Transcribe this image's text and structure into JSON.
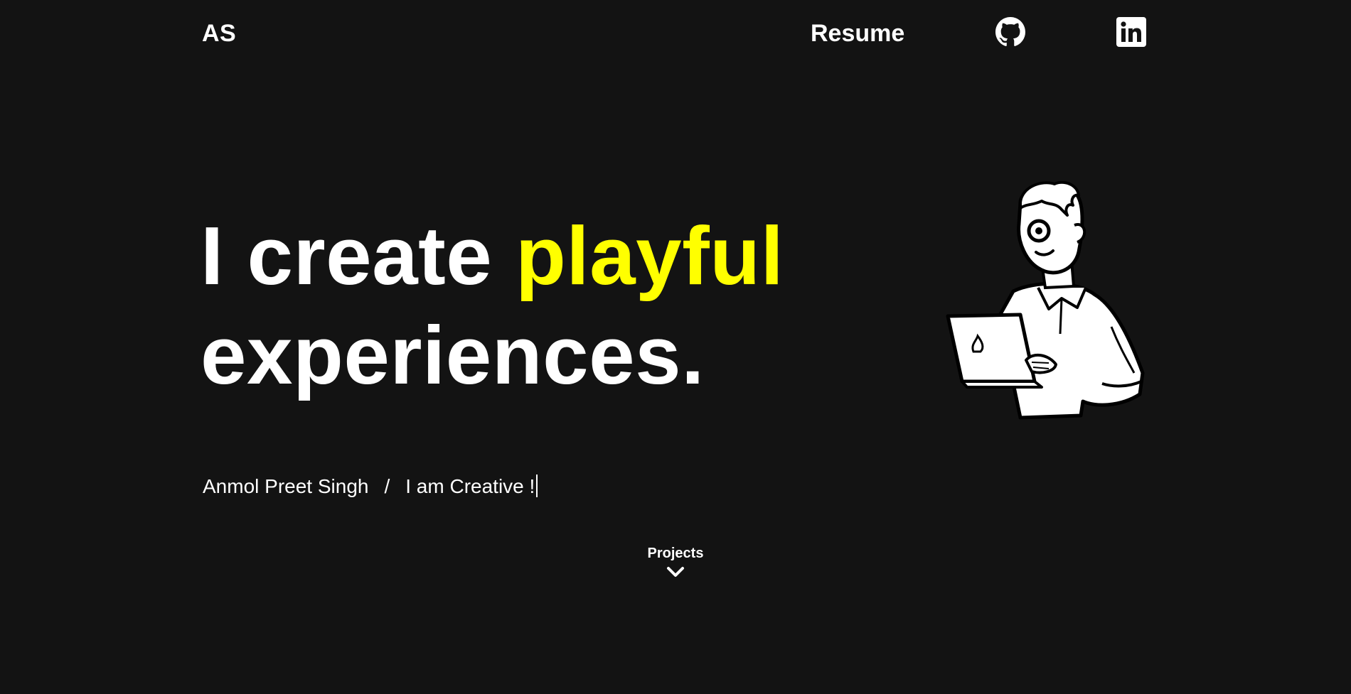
{
  "nav": {
    "logo": "AS",
    "resume_label": "Resume",
    "github_icon": "github-icon",
    "linkedin_icon": "linkedin-icon"
  },
  "hero": {
    "headline_part1": "I create ",
    "headline_accent": "playful",
    "headline_part2": "experiences.",
    "illustration": "man-with-laptop-illustration"
  },
  "tagline": {
    "name": "Anmol Preet Singh",
    "separator": "/",
    "typed_text": "I am Creative !"
  },
  "scroll": {
    "label": "Projects",
    "icon": "chevron-down-icon"
  },
  "colors": {
    "background": "#131313",
    "text": "#ffffff",
    "accent": "#ffff00"
  }
}
